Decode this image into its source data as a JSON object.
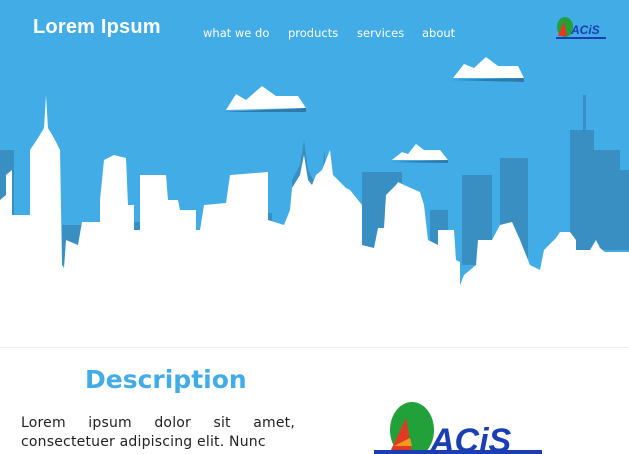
{
  "header": {
    "brand": "Lorem Ipsum",
    "nav": [
      {
        "label": "what we do"
      },
      {
        "label": "products"
      },
      {
        "label": "services"
      },
      {
        "label": "about"
      }
    ],
    "logo_text": "ACiS"
  },
  "description": {
    "title": "Description",
    "text": "Lorem ipsum dolor sit amet, consectetuer adipiscing elit. Nunc"
  },
  "logo": {
    "text": "ACiS"
  },
  "colors": {
    "sky": "#41ace5",
    "skyline_dark": "#3a8fc2",
    "white": "#ffffff",
    "title": "#41ace5",
    "logo_green": "#22a13a",
    "logo_blue": "#1b3fb0",
    "logo_red": "#e23a22",
    "logo_orange": "#f29a1f"
  }
}
